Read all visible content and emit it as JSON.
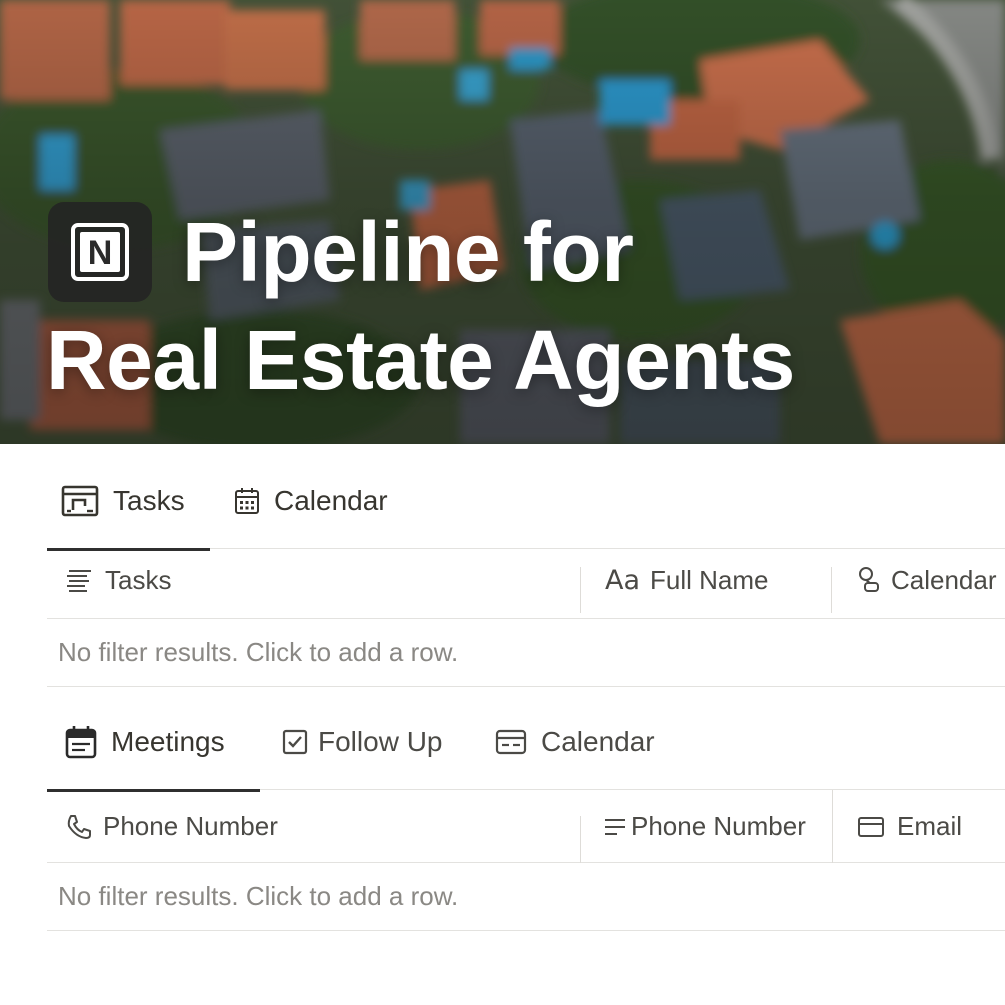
{
  "cover": {
    "title_line1": "Pipeline for",
    "title_line2": "Real Estate Agents",
    "logo_letter": "N",
    "logo_icon": "notion-logo-icon"
  },
  "section1": {
    "tabs": [
      {
        "label": "Tasks",
        "icon": "board-view-icon",
        "active": true
      },
      {
        "label": "Calendar",
        "icon": "calendar-icon",
        "active": false
      }
    ],
    "columns": [
      {
        "label": "Tasks",
        "icon": "list-lines-icon"
      },
      {
        "label": "Full Name",
        "icon": "text-aa-icon"
      },
      {
        "label": "Calendar",
        "icon": "relation-icon"
      }
    ],
    "empty_text": "No filter results. Click to add a row."
  },
  "section2": {
    "tabs": [
      {
        "label": "Meetings",
        "icon": "calendar-board-icon",
        "active": true
      },
      {
        "label": "Follow Up",
        "icon": "checkbox-icon",
        "active": false
      },
      {
        "label": "Calendar",
        "icon": "calendar-card-icon",
        "active": false
      }
    ],
    "columns": [
      {
        "label": "Phone Number",
        "icon": "phone-icon"
      },
      {
        "label": "Phone Number",
        "icon": "text-lines-icon"
      },
      {
        "label": "Email",
        "icon": "card-icon"
      }
    ],
    "empty_text": "No filter results. Click to add a row."
  },
  "colors": {
    "text": "#37352f",
    "muted": "#8a8884",
    "border": "#e3e2df",
    "active_tab_underline": "#2f2f2f"
  }
}
